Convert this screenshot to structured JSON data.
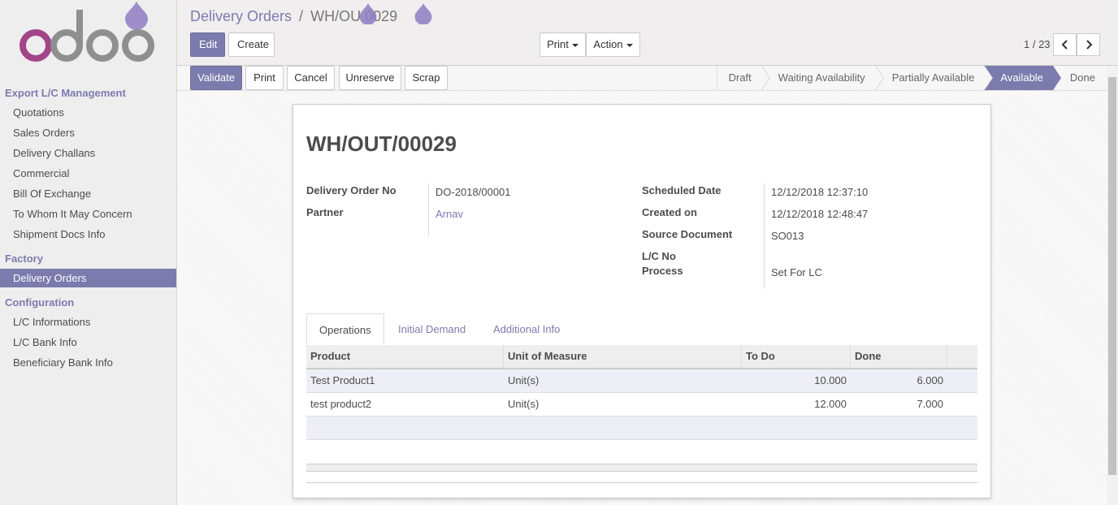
{
  "sidebar": {
    "sections": [
      {
        "title": "Export L/C Management",
        "items": [
          "Quotations",
          "Sales Orders",
          "Delivery Challans",
          "Commercial",
          "Bill Of Exchange",
          "To Whom It May Concern",
          "Shipment Docs Info"
        ]
      },
      {
        "title": "Factory",
        "items": [
          "Delivery Orders"
        ]
      },
      {
        "title": "Configuration",
        "items": [
          "L/C Informations",
          "L/C Bank Info",
          "Beneficiary Bank Info"
        ]
      }
    ],
    "active_item": "Delivery Orders"
  },
  "breadcrumb": {
    "parent": "Delivery Orders",
    "separator": "/",
    "current": "WH/OU  0029"
  },
  "toolbar": {
    "edit_label": "Edit",
    "create_label": "Create",
    "print_label": "Print",
    "action_label": "Action"
  },
  "pager": {
    "value": "1 / 23"
  },
  "statusbar": {
    "buttons": [
      "Validate",
      "Print",
      "Cancel",
      "Unreserve",
      "Scrap"
    ],
    "stages": [
      "Draft",
      "Waiting Availability",
      "Partially Available",
      "Available",
      "Done"
    ],
    "active_stage": "Available"
  },
  "form": {
    "title": "WH/OUT/00029",
    "left_fields": [
      {
        "label": "Delivery Order No",
        "value": "DO-2018/00001"
      },
      {
        "label": "Partner",
        "value": "Arnav"
      }
    ],
    "right_fields": [
      {
        "label": "Scheduled Date",
        "value": "12/12/2018 12:37:10"
      },
      {
        "label": "Created on",
        "value": "12/12/2018 12:48:47"
      },
      {
        "label": "Source Document",
        "value": "SO013"
      },
      {
        "label": "L/C No",
        "value": ""
      },
      {
        "label": "Process",
        "value": "Set For LC"
      }
    ]
  },
  "tabs": [
    "Operations",
    "Initial Demand",
    "Additional Info"
  ],
  "table": {
    "columns": [
      "Product",
      "Unit of Measure",
      "To Do",
      "Done"
    ],
    "rows": [
      [
        "Test Product1",
        "Unit(s)",
        "10.000",
        "6.000"
      ],
      [
        "test product2",
        "Unit(s)",
        "12.000",
        "7.000"
      ]
    ]
  },
  "colors": {
    "brand": "#7c7bad",
    "logo_o": "#a24689",
    "logo_doo": "#8f8f8f",
    "drop": "#8e7cc3"
  }
}
